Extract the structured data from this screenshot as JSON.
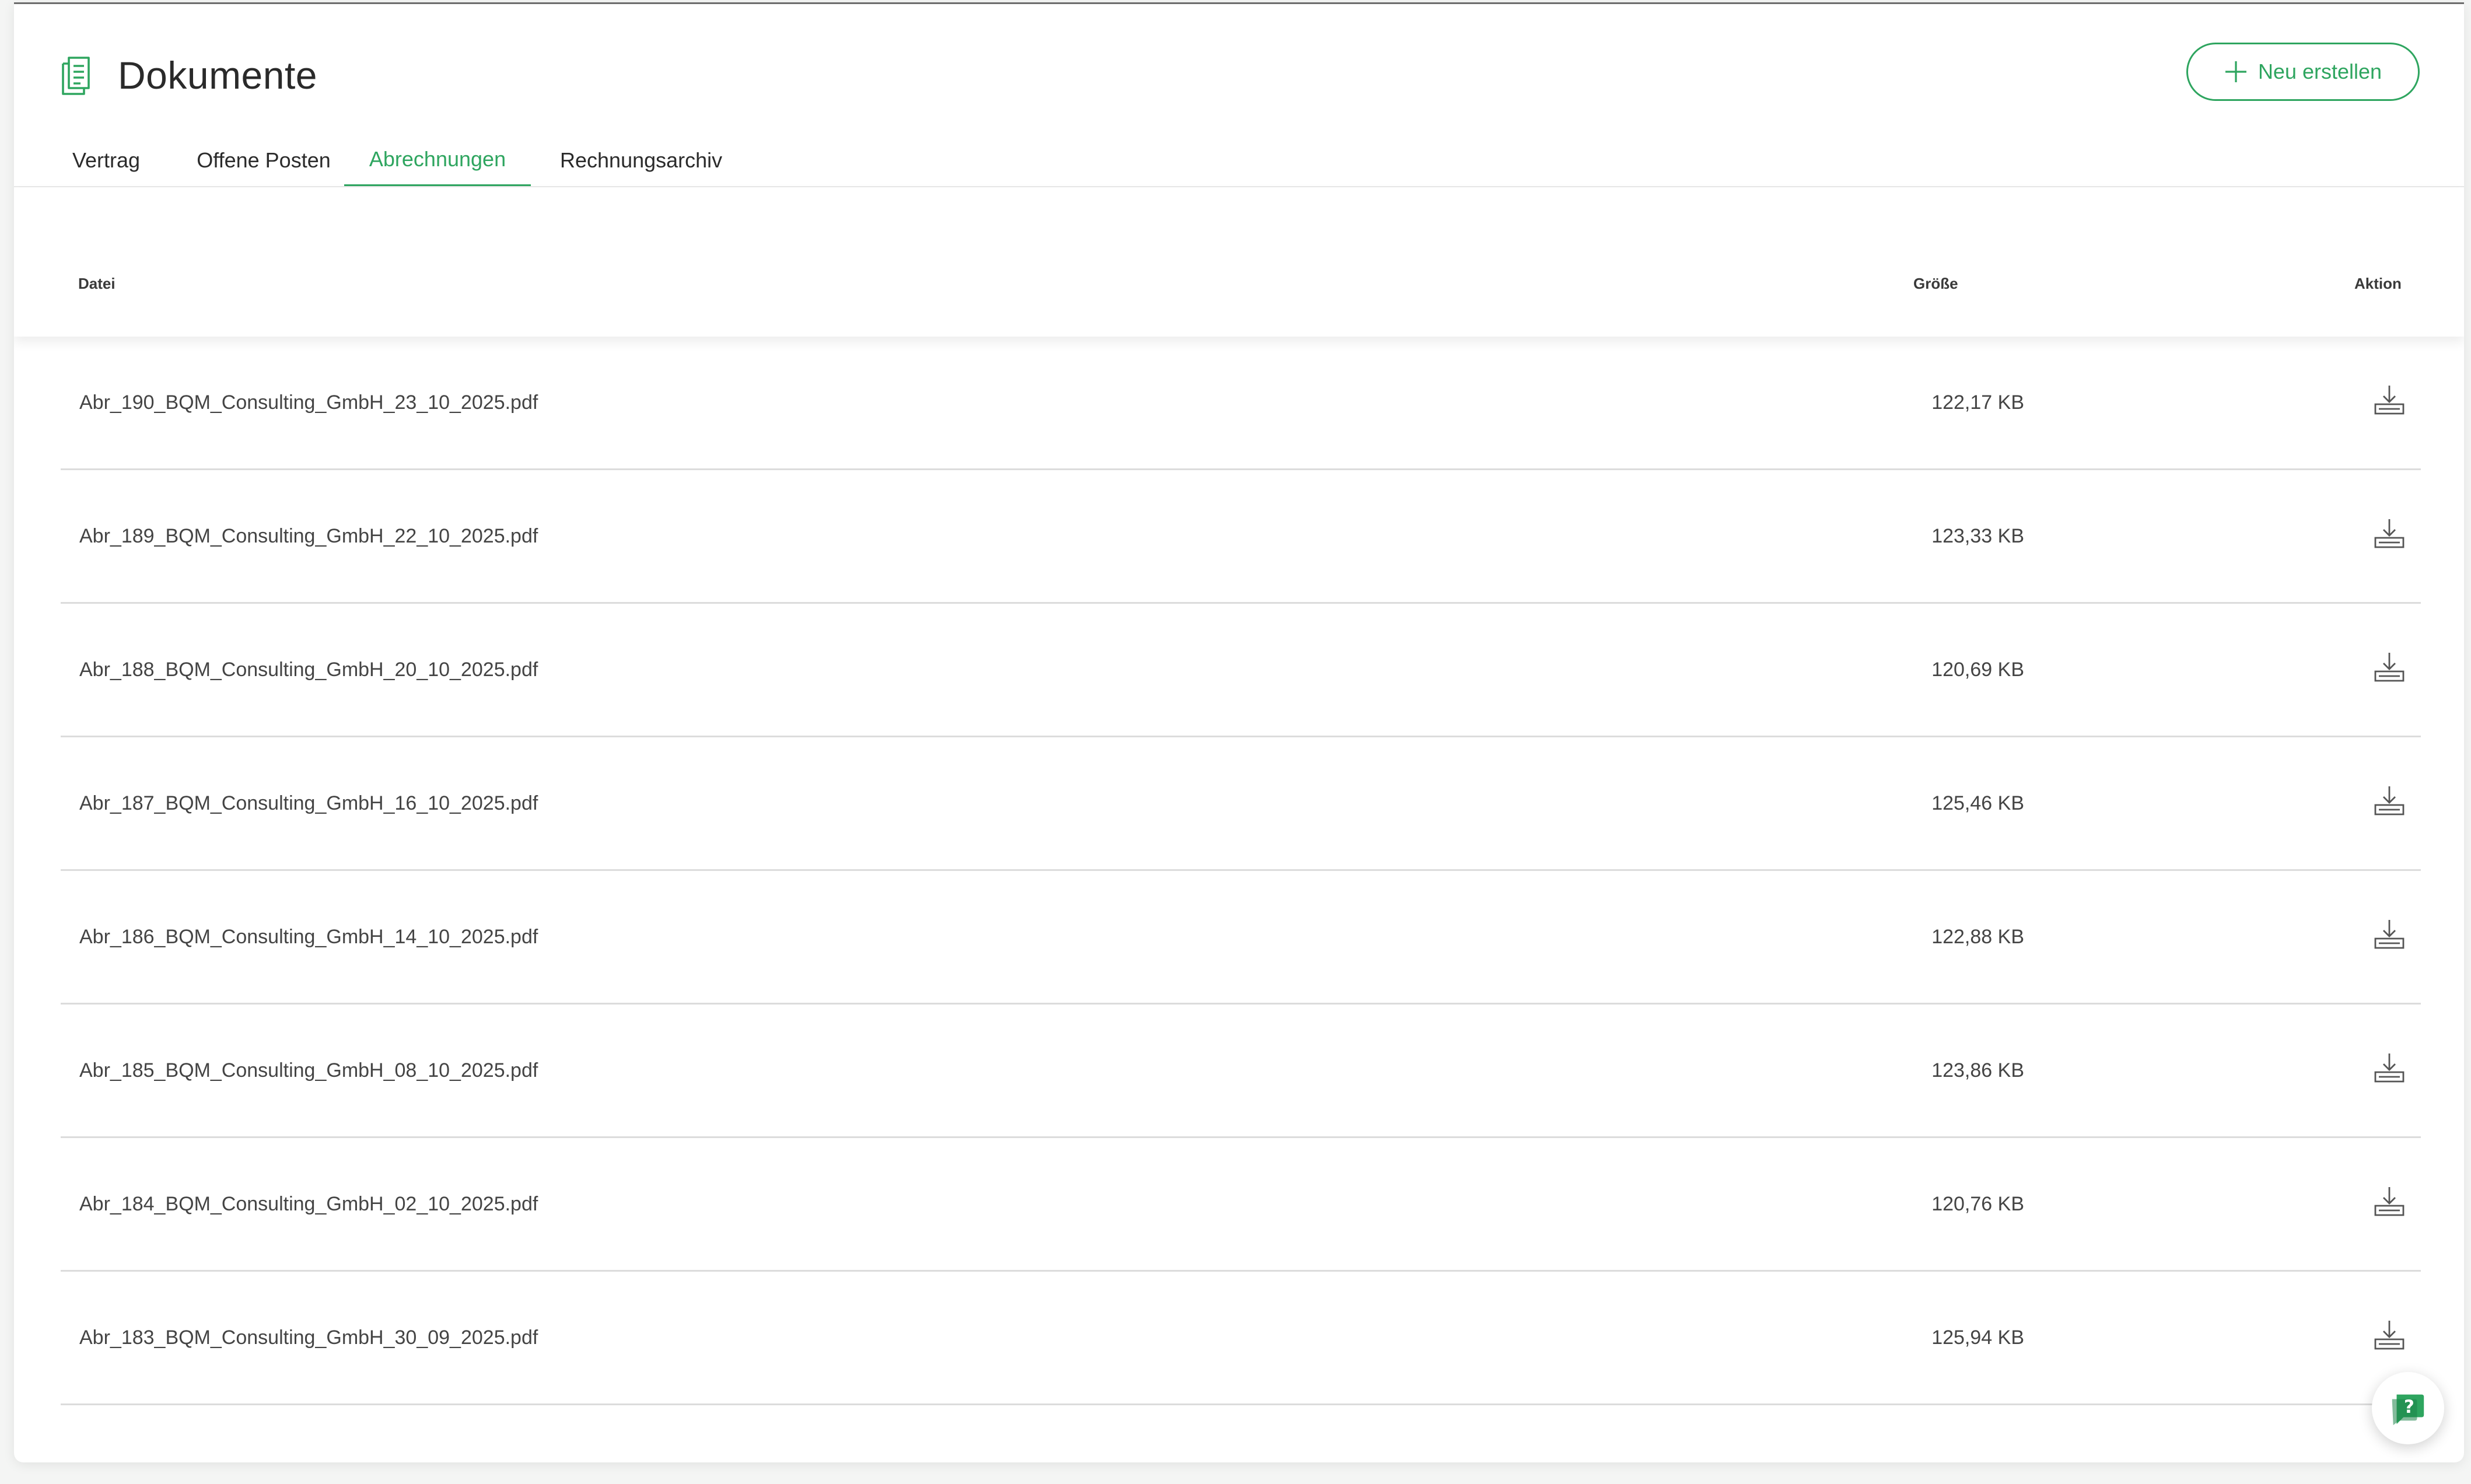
{
  "header": {
    "title": "Dokumente",
    "new_button_label": "Neu erstellen"
  },
  "tabs": [
    {
      "label": "Vertrag",
      "active": false
    },
    {
      "label": "Offene Posten",
      "active": false
    },
    {
      "label": "Abrechnungen",
      "active": true
    },
    {
      "label": "Rechnungsarchiv",
      "active": false
    }
  ],
  "table": {
    "columns": {
      "file": "Datei",
      "size": "Größe",
      "action": "Aktion"
    },
    "rows": [
      {
        "file": "Abr_190_BQM_Consulting_GmbH_23_10_2025.pdf",
        "size": "122,17 KB"
      },
      {
        "file": "Abr_189_BQM_Consulting_GmbH_22_10_2025.pdf",
        "size": "123,33 KB"
      },
      {
        "file": "Abr_188_BQM_Consulting_GmbH_20_10_2025.pdf",
        "size": "120,69 KB"
      },
      {
        "file": "Abr_187_BQM_Consulting_GmbH_16_10_2025.pdf",
        "size": "125,46 KB"
      },
      {
        "file": "Abr_186_BQM_Consulting_GmbH_14_10_2025.pdf",
        "size": "122,88 KB"
      },
      {
        "file": "Abr_185_BQM_Consulting_GmbH_08_10_2025.pdf",
        "size": "123,86 KB"
      },
      {
        "file": "Abr_184_BQM_Consulting_GmbH_02_10_2025.pdf",
        "size": "120,76 KB"
      },
      {
        "file": "Abr_183_BQM_Consulting_GmbH_30_09_2025.pdf",
        "size": "125,94 KB"
      }
    ]
  },
  "icons": {
    "title": "document-icon",
    "new_button": "plus-icon",
    "row_action": "download-icon",
    "help": "help-chat-icon"
  },
  "colors": {
    "accent": "#2ea55f",
    "text": "#2b2b2b",
    "divider": "#dcdcdc"
  }
}
